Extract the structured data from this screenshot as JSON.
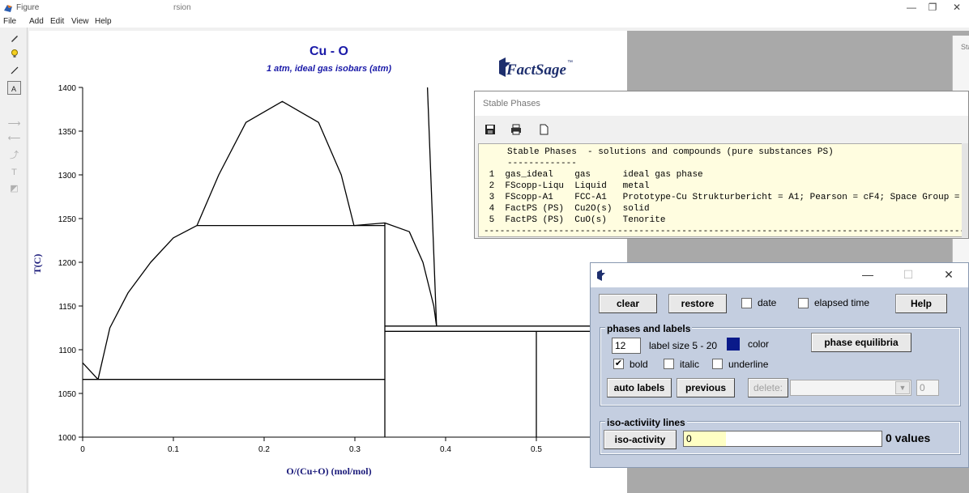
{
  "window": {
    "title": "Figure",
    "title_fragment": "rsion",
    "minimize": "—",
    "restore": "❐",
    "close": "✕"
  },
  "menu": [
    "File",
    "Add",
    "Edit",
    "View",
    "Help"
  ],
  "plot": {
    "title": "Cu - O",
    "subtitle": "1 atm, ideal gas isobars (atm)",
    "logo": "FactSage",
    "logo_tm": "™"
  },
  "chart_data": {
    "type": "line",
    "title": "Cu - O",
    "subtitle": "1 atm, ideal gas isobars (atm)",
    "xlabel": "O/(Cu+O) (mol/mol)",
    "ylabel": "T(C)",
    "xlim": [
      0,
      0.6
    ],
    "ylim": [
      1000,
      1400
    ],
    "x_ticks": [
      "0",
      "0.1",
      "0.2",
      "0.3",
      "0.4",
      "0.5"
    ],
    "y_ticks": [
      "1000",
      "1050",
      "1100",
      "1150",
      "1200",
      "1250",
      "1300",
      "1350",
      "1400"
    ],
    "series": [
      {
        "points": [
          [
            0.126,
            1242
          ],
          [
            0.15,
            1300
          ],
          [
            0.18,
            1360
          ],
          [
            0.22,
            1384
          ],
          [
            0.26,
            1360
          ],
          [
            0.285,
            1300
          ],
          [
            0.299,
            1242
          ]
        ]
      },
      {
        "points": [
          [
            0.017,
            1066
          ],
          [
            0.03,
            1125
          ],
          [
            0.05,
            1165
          ],
          [
            0.075,
            1200
          ],
          [
            0.1,
            1228
          ],
          [
            0.126,
            1242
          ]
        ]
      },
      {
        "points": [
          [
            0.0,
            1085
          ],
          [
            0.017,
            1066
          ]
        ]
      },
      {
        "points": [
          [
            0.299,
            1242
          ],
          [
            0.333,
            1245
          ],
          [
            0.36,
            1235
          ],
          [
            0.375,
            1200
          ],
          [
            0.387,
            1150
          ],
          [
            0.39,
            1127
          ]
        ]
      },
      {
        "points": [
          [
            0.38,
            1400
          ],
          [
            0.39,
            1127
          ]
        ]
      },
      {
        "points": [
          [
            0.0,
            1066
          ],
          [
            0.333,
            1066
          ]
        ]
      },
      {
        "points": [
          [
            0.126,
            1242
          ],
          [
            0.333,
            1242
          ]
        ]
      },
      {
        "points": [
          [
            0.333,
            1000
          ],
          [
            0.333,
            1245
          ]
        ]
      },
      {
        "points": [
          [
            0.333,
            1127
          ],
          [
            0.6,
            1127
          ]
        ]
      },
      {
        "points": [
          [
            0.333,
            1121
          ],
          [
            0.6,
            1121
          ]
        ]
      },
      {
        "points": [
          [
            0.5,
            1000
          ],
          [
            0.5,
            1121
          ]
        ]
      }
    ]
  },
  "stable_phases": {
    "title": "Stable Phases",
    "header": "Stable Phases  - solutions and compounds (pure substances PS)",
    "underline": "-------------",
    "rows": [
      " 1  gas_ideal    gas      ideal gas phase",
      " 2  FScopp-Liqu  Liquid   metal",
      " 3  FScopp-A1    FCC-A1   Prototype-Cu Strukturbericht = A1; Pearson = cF4; Space Group =",
      " 4  FactPS (PS)  Cu2O(s)  solid",
      " 5  FactPS (PS)  CuO(s)   Tenorite"
    ],
    "footer": "------------------------------------------------------------------------------------------"
  },
  "side_window": {
    "title": "Sta"
  },
  "controls": {
    "minimize": "—",
    "maximize": "☐",
    "close": "✕",
    "clear": "clear",
    "restore": "restore",
    "date": "date",
    "elapsed_time": "elapsed time",
    "help": "Help",
    "phases_group": "phases and labels",
    "label_size_value": "12",
    "label_size": "label size 5 - 20",
    "color": "color",
    "color_hex": "#0a1a8a",
    "phase_equilibria": "phase equilibria",
    "bold": "bold",
    "italic": "italic",
    "underline": "underline",
    "auto_labels": "auto labels",
    "previous": "previous",
    "delete": "delete:",
    "delete_count": "0",
    "iso_group": "iso-activiity lines",
    "iso_activity": "iso-activity",
    "iso_value": "0",
    "values": "0 values"
  }
}
